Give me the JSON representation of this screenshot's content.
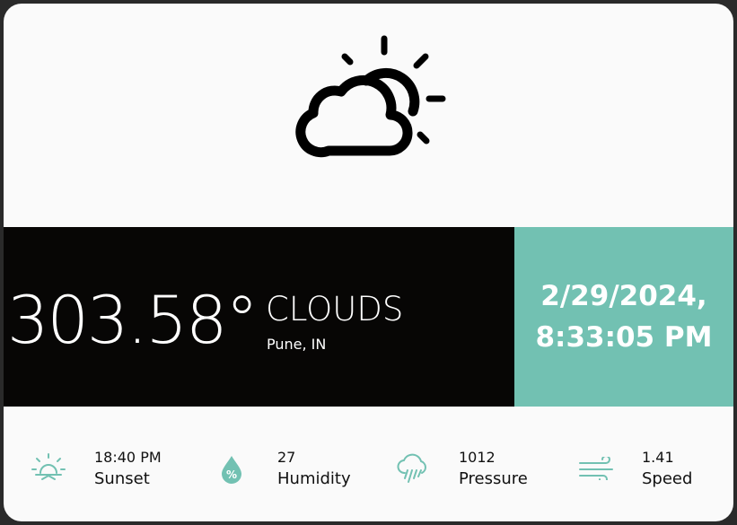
{
  "weather": {
    "icon": "partly-cloudy-icon",
    "temperature": "303.58°",
    "condition": "CLOUDS",
    "location": "Pune, IN"
  },
  "datetime": {
    "date": "2/29/2024,",
    "time": "8:33:05 PM"
  },
  "stats": [
    {
      "icon": "sunset-icon",
      "value": "18:40 PM",
      "label": "Sunset"
    },
    {
      "icon": "humidity-drop-icon",
      "value": "27",
      "label": "Humidity"
    },
    {
      "icon": "rain-cloud-icon",
      "value": "1012",
      "label": "Pressure"
    },
    {
      "icon": "wind-icon",
      "value": "1.41",
      "label": "Speed"
    }
  ],
  "colors": {
    "accent": "#72c1b2",
    "band_dark": "#070605",
    "card_background": "#fafafa"
  }
}
